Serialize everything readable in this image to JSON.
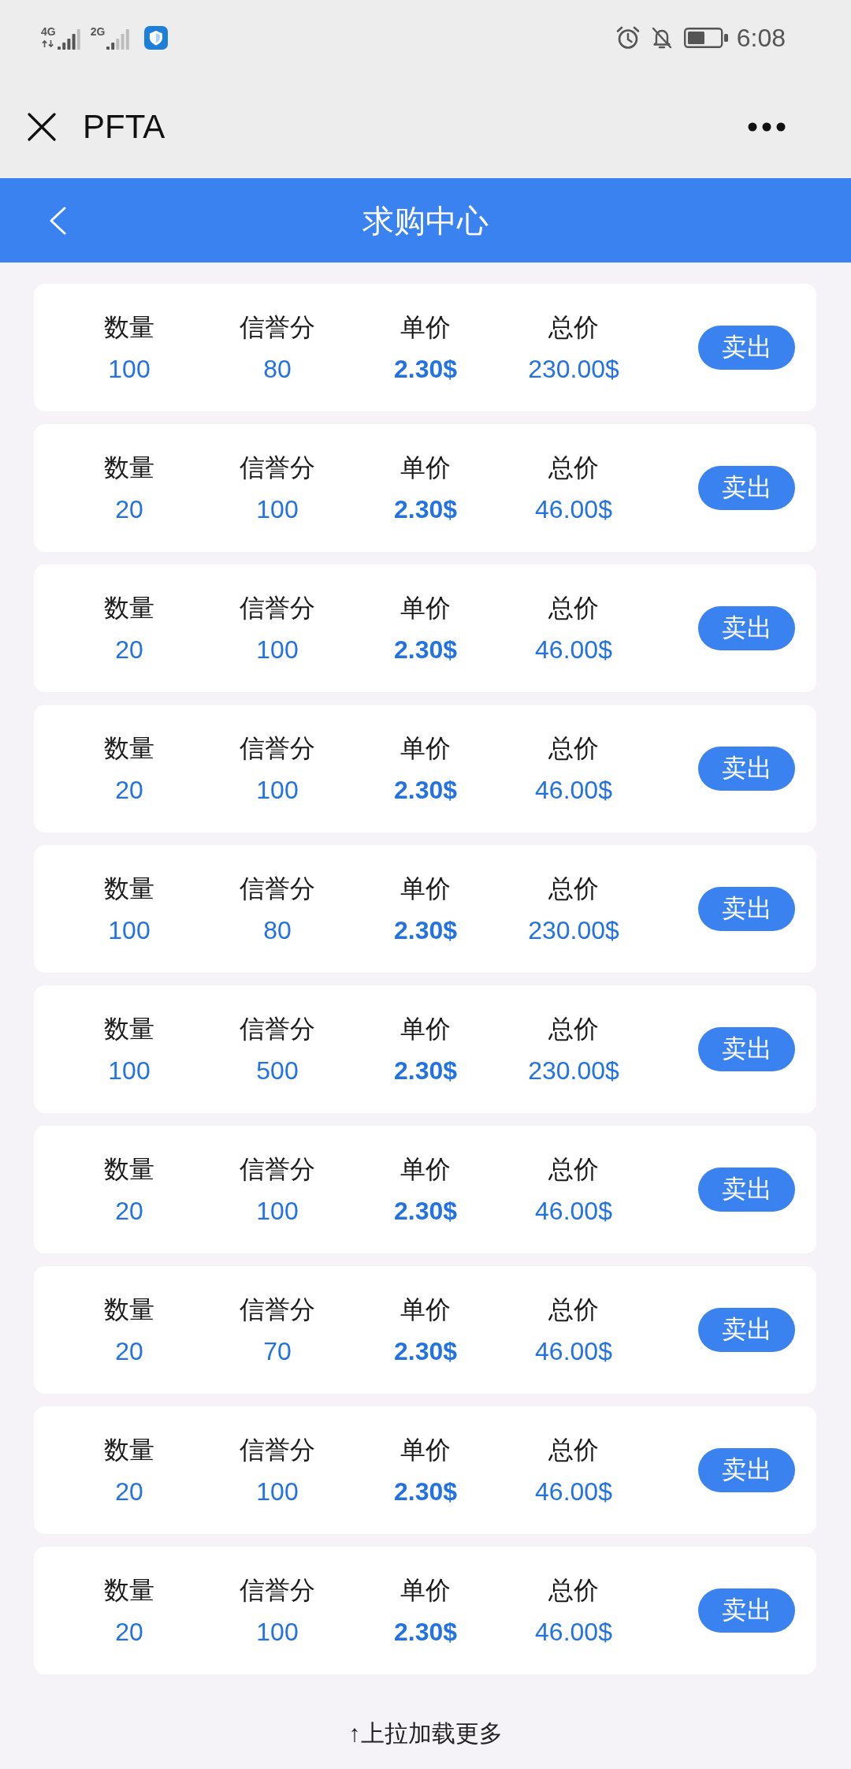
{
  "status_bar": {
    "networks": [
      {
        "label": "4G"
      },
      {
        "label": "2G"
      }
    ],
    "time": "6:08"
  },
  "title_bar": {
    "title": "PFTA"
  },
  "header": {
    "title": "求购中心"
  },
  "orders": [
    {
      "fields": [
        {
          "label": "数量",
          "value": "100"
        },
        {
          "label": "信誉分",
          "value": "80"
        },
        {
          "label": "单价",
          "value": "2.30$"
        },
        {
          "label": "总价",
          "value": "230.00$"
        }
      ],
      "action": "卖出"
    },
    {
      "fields": [
        {
          "label": "数量",
          "value": "20"
        },
        {
          "label": "信誉分",
          "value": "100"
        },
        {
          "label": "单价",
          "value": "2.30$"
        },
        {
          "label": "总价",
          "value": "46.00$"
        }
      ],
      "action": "卖出"
    },
    {
      "fields": [
        {
          "label": "数量",
          "value": "20"
        },
        {
          "label": "信誉分",
          "value": "100"
        },
        {
          "label": "单价",
          "value": "2.30$"
        },
        {
          "label": "总价",
          "value": "46.00$"
        }
      ],
      "action": "卖出"
    },
    {
      "fields": [
        {
          "label": "数量",
          "value": "20"
        },
        {
          "label": "信誉分",
          "value": "100"
        },
        {
          "label": "单价",
          "value": "2.30$"
        },
        {
          "label": "总价",
          "value": "46.00$"
        }
      ],
      "action": "卖出"
    },
    {
      "fields": [
        {
          "label": "数量",
          "value": "100"
        },
        {
          "label": "信誉分",
          "value": "80"
        },
        {
          "label": "单价",
          "value": "2.30$"
        },
        {
          "label": "总价",
          "value": "230.00$"
        }
      ],
      "action": "卖出"
    },
    {
      "fields": [
        {
          "label": "数量",
          "value": "100"
        },
        {
          "label": "信誉分",
          "value": "500"
        },
        {
          "label": "单价",
          "value": "2.30$"
        },
        {
          "label": "总价",
          "value": "230.00$"
        }
      ],
      "action": "卖出"
    },
    {
      "fields": [
        {
          "label": "数量",
          "value": "20"
        },
        {
          "label": "信誉分",
          "value": "100"
        },
        {
          "label": "单价",
          "value": "2.30$"
        },
        {
          "label": "总价",
          "value": "46.00$"
        }
      ],
      "action": "卖出"
    },
    {
      "fields": [
        {
          "label": "数量",
          "value": "20"
        },
        {
          "label": "信誉分",
          "value": "70"
        },
        {
          "label": "单价",
          "value": "2.30$"
        },
        {
          "label": "总价",
          "value": "46.00$"
        }
      ],
      "action": "卖出"
    },
    {
      "fields": [
        {
          "label": "数量",
          "value": "20"
        },
        {
          "label": "信誉分",
          "value": "100"
        },
        {
          "label": "单价",
          "value": "2.30$"
        },
        {
          "label": "总价",
          "value": "46.00$"
        }
      ],
      "action": "卖出"
    },
    {
      "fields": [
        {
          "label": "数量",
          "value": "20"
        },
        {
          "label": "信誉分",
          "value": "100"
        },
        {
          "label": "单价",
          "value": "2.30$"
        },
        {
          "label": "总价",
          "value": "46.00$"
        }
      ],
      "action": "卖出"
    }
  ],
  "footer": {
    "hint": "↑上拉加载更多"
  }
}
